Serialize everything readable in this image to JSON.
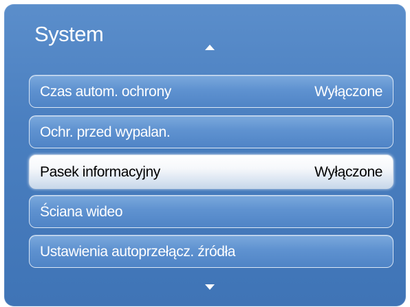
{
  "menu": {
    "title": "System",
    "items": [
      {
        "label": "Czas autom. ochrony",
        "value": "Wyłączone",
        "selected": false
      },
      {
        "label": "Ochr. przed wypalan.",
        "value": "",
        "selected": false
      },
      {
        "label": "Pasek informacyjny",
        "value": "Wyłączone",
        "selected": true
      },
      {
        "label": "Ściana wideo",
        "value": "",
        "selected": false
      },
      {
        "label": "Ustawienia autoprzełącz. źródła",
        "value": "",
        "selected": false
      }
    ]
  },
  "icons": {
    "scroll_up": "triangle-up-icon",
    "scroll_down": "triangle-down-icon"
  },
  "colors": {
    "panel": "#4a7fc0",
    "item": "#5f92d0",
    "selected_item": "#f2f6fb",
    "text": "#ffffff",
    "selected_text": "#000000"
  }
}
